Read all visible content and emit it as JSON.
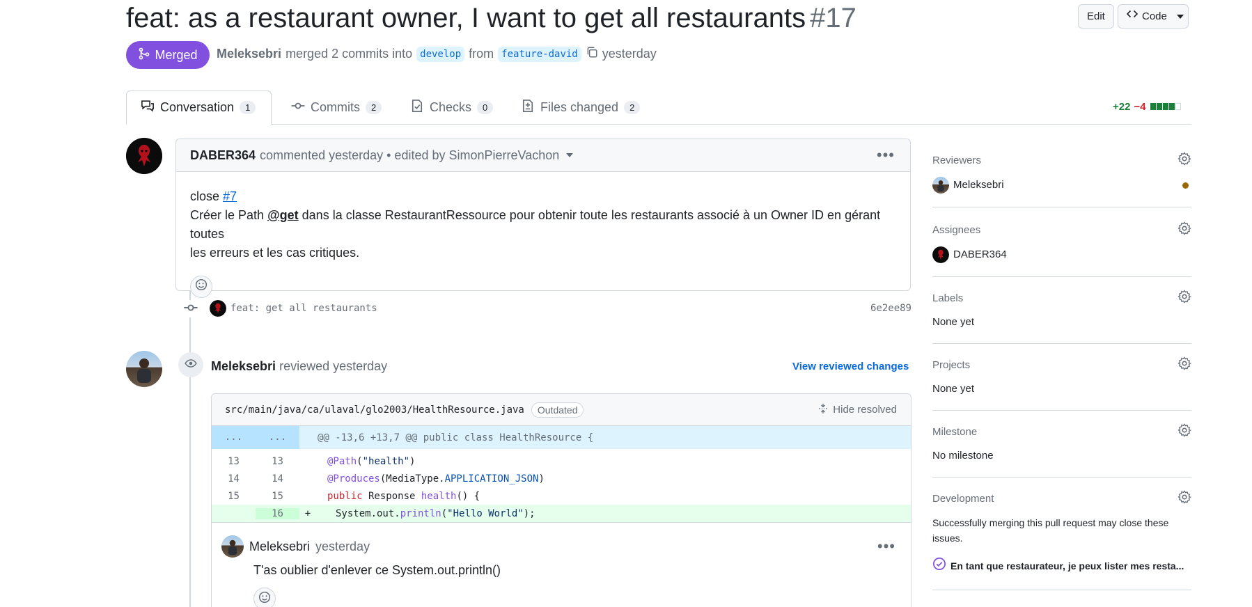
{
  "header": {
    "title": "feat: as a restaurant owner, I want to get all restaurants",
    "number": "#17",
    "edit_label": "Edit",
    "code_label": "Code",
    "status": "Merged",
    "merged_by": "Meleksebri",
    "merged_text": "merged 2 commits into",
    "base_branch": "develop",
    "from_text": "from",
    "head_branch": "feature-david",
    "when": "yesterday"
  },
  "tabs": [
    {
      "label": "Conversation",
      "count": "1",
      "icon": "conversation-icon"
    },
    {
      "label": "Commits",
      "count": "2",
      "icon": "commit-icon"
    },
    {
      "label": "Checks",
      "count": "0",
      "icon": "checks-icon"
    },
    {
      "label": "Files changed",
      "count": "2",
      "icon": "file-diff-icon"
    }
  ],
  "diffstat": {
    "additions": "+22",
    "deletions": "−4"
  },
  "comment": {
    "author": "DABER364",
    "meta": "commented yesterday • edited by SimonPierreVachon",
    "line1_prefix": "close",
    "line1_link": "#7",
    "line2_a": "Créer le Path",
    "line2_mention": "@get",
    "line2_b": "dans la classe RestaurantRessource pour obtenir toute les restaurants associé à un Owner ID en gérant toutes",
    "line3": "les erreurs et les cas critiques."
  },
  "commit": {
    "message": "feat: get all restaurants",
    "sha": "6e2ee89"
  },
  "review": {
    "author": "Meleksebri",
    "meta": "reviewed yesterday",
    "view_changes": "View reviewed changes",
    "file_path": "src/main/java/ca/ulaval/glo2003/HealthResource.java",
    "outdated": "Outdated",
    "hide_resolved": "Hide resolved",
    "hunk_left": "...",
    "hunk_right": "...",
    "hunk_header": "@@ -13,6 +13,7 @@ public class HealthResource {",
    "lines": [
      {
        "old": "13",
        "new": "13",
        "marker": ""
      },
      {
        "old": "14",
        "new": "14",
        "marker": ""
      },
      {
        "old": "15",
        "new": "15",
        "marker": ""
      },
      {
        "old": "",
        "new": "16",
        "marker": "+"
      }
    ],
    "code": {
      "l1_ann": "@Path",
      "l1_rest": "(",
      "l1_str": "\"health\"",
      "l1_end": ")",
      "l2_ann": "@Produces",
      "l2_a": "(MediaType.",
      "l2_const": "APPLICATION_JSON",
      "l2_end": ")",
      "l3_kw": "public",
      "l3_a": " Response ",
      "l3_fn": "health",
      "l3_end": "() {",
      "l4_a": "System.out.",
      "l4_fn": "println",
      "l4_b": "(",
      "l4_str": "\"Hello World\"",
      "l4_end": ");"
    },
    "inline_comment": {
      "author": "Meleksebri",
      "when": "yesterday",
      "body": "T'as oublier d'enlever ce System.out.println()"
    }
  },
  "sidebar": {
    "reviewers": {
      "title": "Reviewers",
      "value": "Meleksebri"
    },
    "assignees": {
      "title": "Assignees",
      "value": "DABER364"
    },
    "labels": {
      "title": "Labels",
      "value": "None yet"
    },
    "projects": {
      "title": "Projects",
      "value": "None yet"
    },
    "milestone": {
      "title": "Milestone",
      "value": "No milestone"
    },
    "development": {
      "title": "Development",
      "value": "Successfully merging this pull request may close these issues.",
      "issue": "En tant que restaurateur, je peux lister mes resta..."
    }
  },
  "colors": {
    "merged": "#8250df",
    "link": "#0969da",
    "addition": "#1a7f37",
    "deletion": "#cf222e"
  }
}
